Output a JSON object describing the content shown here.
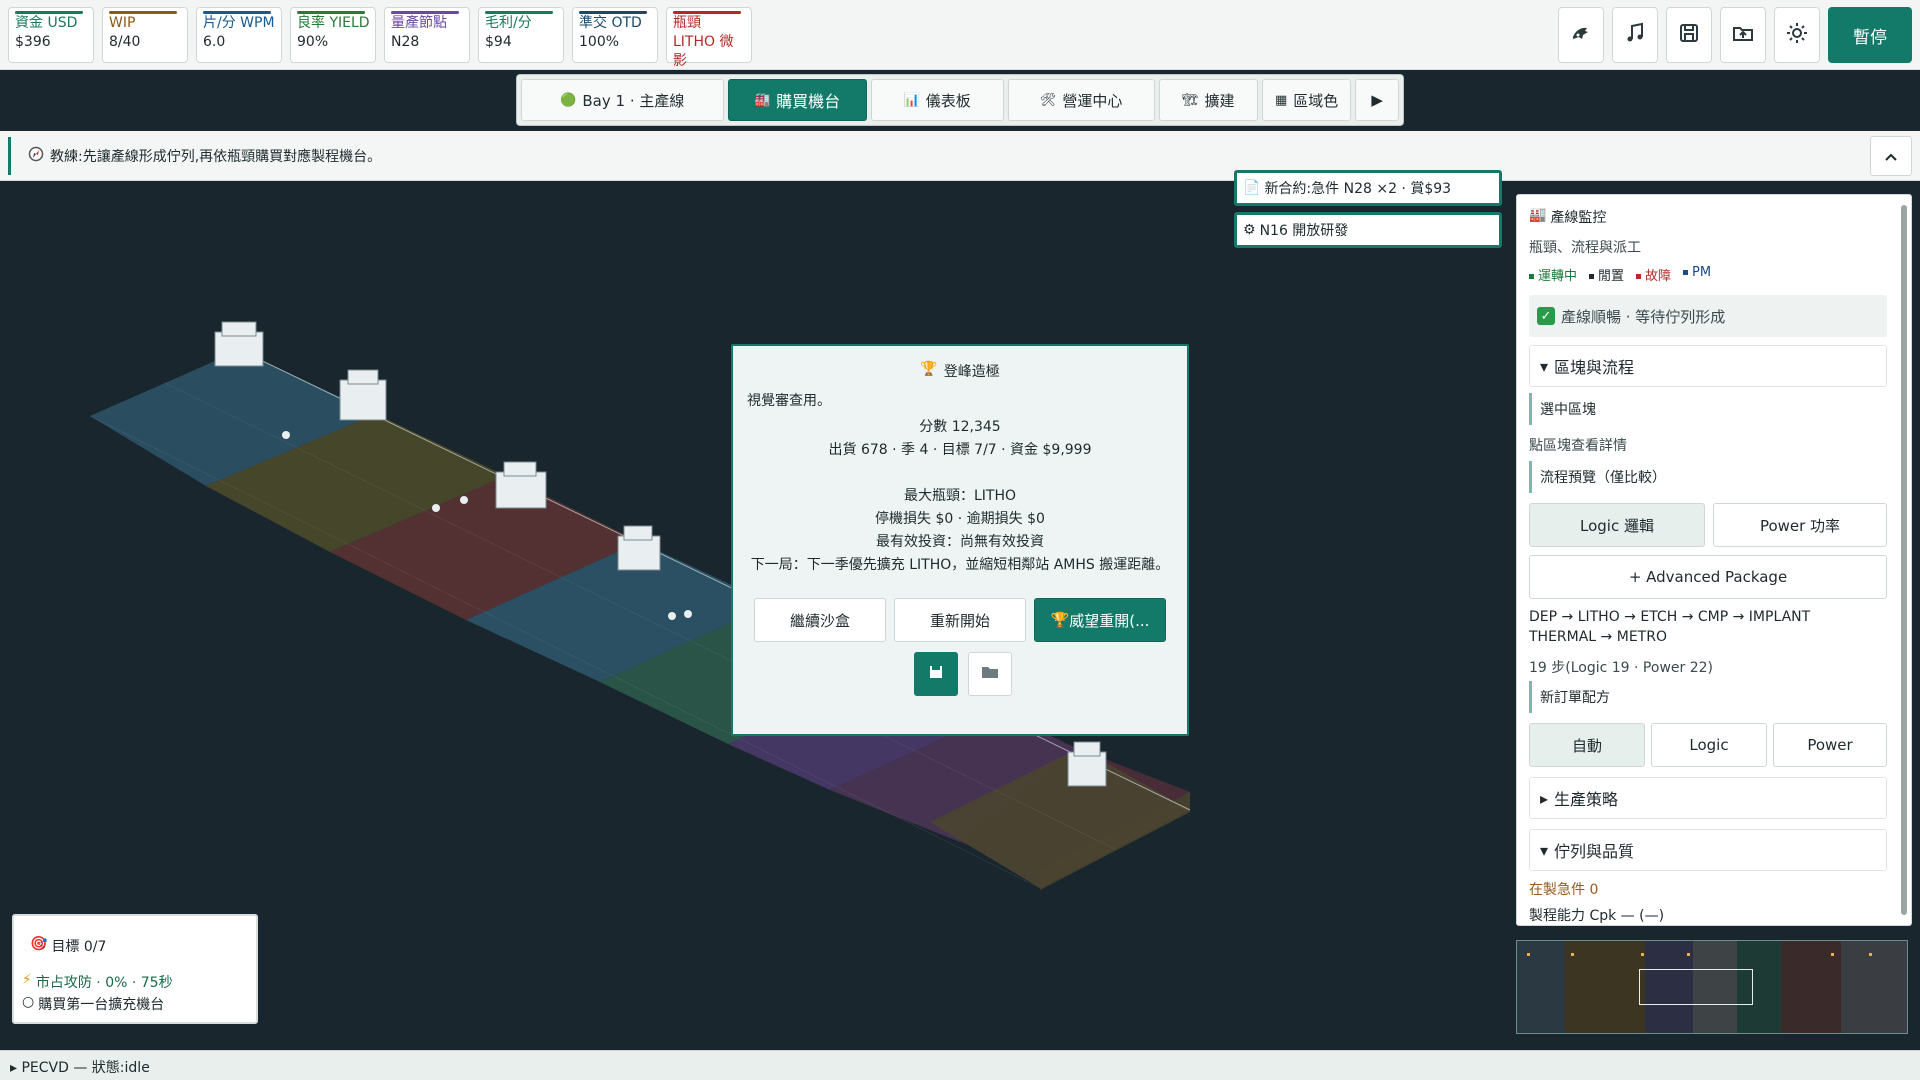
{
  "stats": [
    {
      "key": "資金 USD",
      "value": "$396",
      "color": "#1a7a5a",
      "alert": false
    },
    {
      "key": "WIP",
      "value": "8/40",
      "color": "#8a5a1a",
      "alert": false
    },
    {
      "key": "片/分 WPM",
      "value": "6.0",
      "color": "#1a5a8a",
      "alert": false
    },
    {
      "key": "良率 YIELD",
      "value": "90%",
      "color": "#2a7a3a",
      "alert": false
    },
    {
      "key": "量產節點",
      "value": "N28",
      "color": "#6a4aa0",
      "alert": false
    },
    {
      "key": "毛利/分",
      "value": "$94",
      "color": "#1a7a5a",
      "alert": false
    },
    {
      "key": "準交 OTD",
      "value": "100%",
      "color": "#1a4a6a",
      "alert": false
    },
    {
      "key": "瓶頸",
      "value": "LITHO 微影",
      "color": "#b22a26",
      "alert": true
    }
  ],
  "tools": [
    "graphics-icon",
    "music-icon",
    "save-icon",
    "open-folder-icon",
    "theme-icon"
  ],
  "pause_label": "暫停",
  "tabs": [
    {
      "label": "Bay 1 · 主產線",
      "icon": "green-dot-icon",
      "width": 204
    },
    {
      "label": "購買機台",
      "icon": "factory-icon",
      "width": 140,
      "active": true
    },
    {
      "label": "儀表板",
      "icon": "chart-icon",
      "width": 134
    },
    {
      "label": "營運中心",
      "icon": "tools-icon",
      "width": 148
    },
    {
      "label": "擴建",
      "icon": "crane-icon",
      "width": 100
    },
    {
      "label": "區域色",
      "icon": "grid-icon",
      "width": 90
    },
    {
      "label": "▶",
      "icon": "play-icon",
      "width": 44
    }
  ],
  "coach": {
    "text": "教練:先讓產線形成佇列,再依瓶頸購買對應製程機台。"
  },
  "contracts": [
    {
      "text": "新合約:急件 N28 ×2 · 賞$93"
    },
    {
      "text": "N16 開放研發"
    }
  ],
  "modal": {
    "title": "登峰造極",
    "sub": "視覺審查用。",
    "score": "分數 12,345",
    "summary": "出貨 678 · 季 4 · 目標 7/7 · 資金 $9,999",
    "bottleneck": "最大瓶頸：LITHO",
    "losses": "停機損失 $0 · 逾期損失 $0",
    "invest": "最有效投資：尚無有效投資",
    "next": "下一局：下一季優先擴充 LITHO，並縮短相鄰站 AMHS 搬運距離。",
    "btn_continue": "繼續沙盒",
    "btn_restart": "重新開始",
    "btn_prestige": "威望重開(..."
  },
  "panel": {
    "title": "產線監控",
    "subtitle": "瓶頸、流程與派工",
    "legend": [
      {
        "label": "運轉中",
        "color": "#1a7a3a"
      },
      {
        "label": "閒置",
        "color": "#1e2a2d"
      },
      {
        "label": "故障",
        "color": "#b22a26"
      },
      {
        "label": "PM",
        "color": "#1a4a8a"
      }
    ],
    "status_ok": "產線順暢 · 等待佇列形成",
    "section_zone": "區塊與流程",
    "selected_zone": "選中區塊",
    "zone_hint": "點區塊查看詳情",
    "flow_preview": "流程預覽（僅比較）",
    "btn_logic": "Logic 邏輯",
    "btn_power": "Power 功率",
    "btn_advanced": "+ Advanced Package",
    "flow_line1": "DEP → LITHO → ETCH → CMP → IMPLANT",
    "flow_line2": "THERMAL → METRO",
    "steps": "19 步(Logic 19 · Power 22)",
    "recipe_title": "新訂單配方",
    "recipe_auto": "自動",
    "recipe_logic": "Logic",
    "recipe_power": "Power",
    "section_strategy": "生產策略",
    "section_queue": "佇列與品質",
    "rush": "在製急件 0",
    "cpk": "製程能力 Cpk — (—)"
  },
  "goal": {
    "title": "目標 0/7",
    "attack": "市占攻防 · 0% · 75秒",
    "task": "購買第一台擴充機台"
  },
  "status_text": "PECVD — 狀態:idle",
  "colors": {
    "accent": "#137a6a",
    "alert": "#b22a26"
  }
}
